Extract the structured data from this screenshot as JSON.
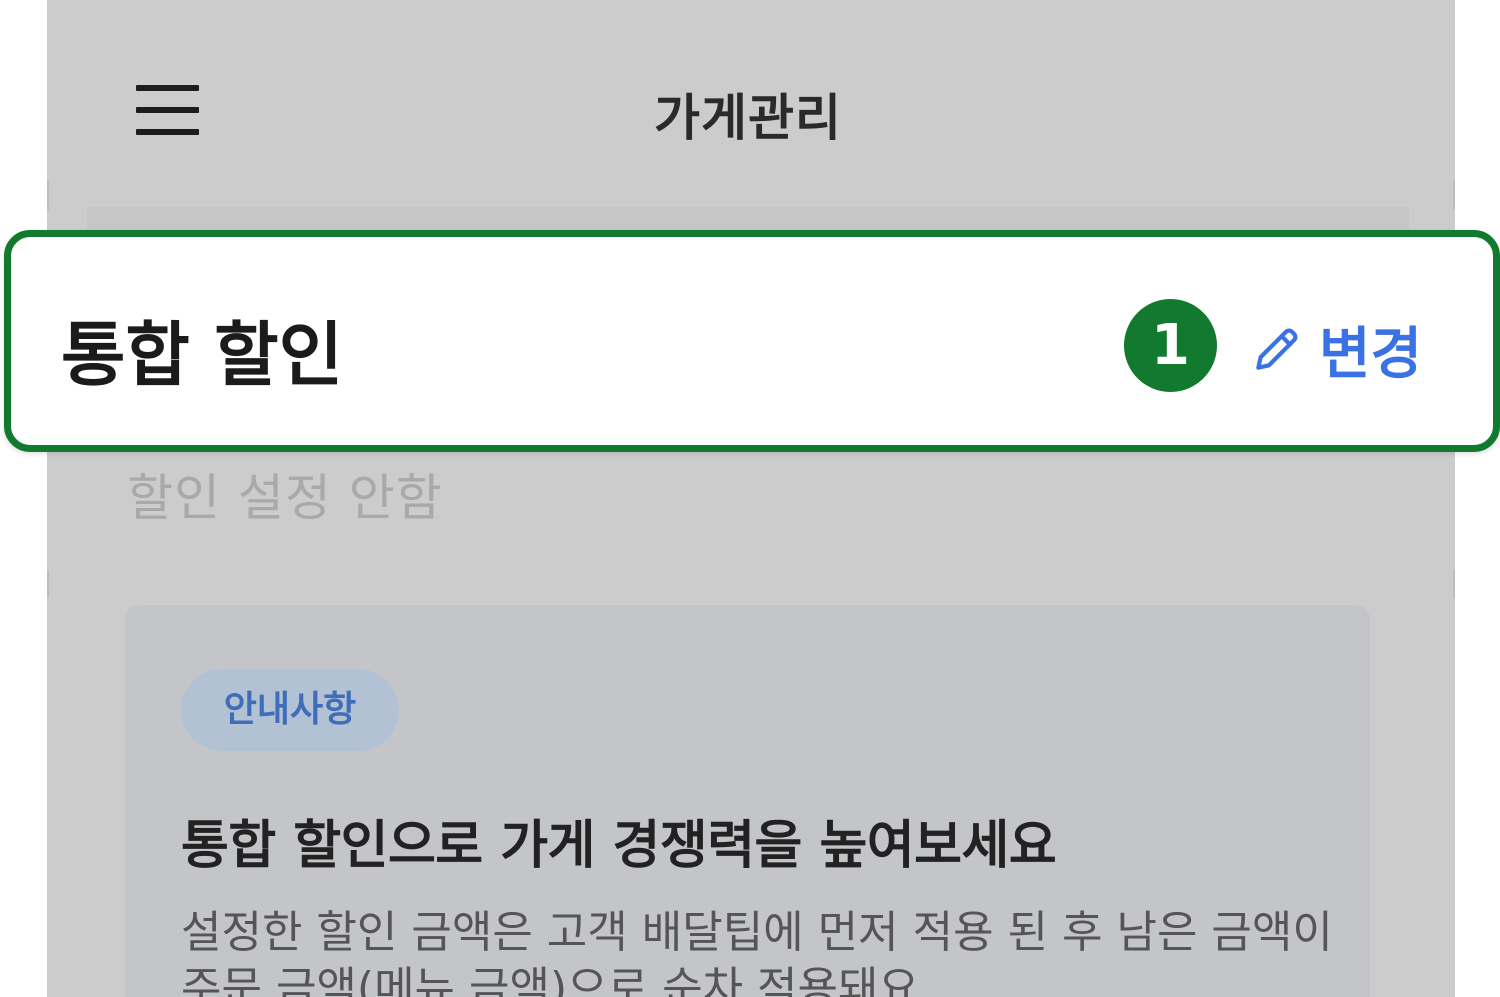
{
  "header": {
    "title": "가게관리",
    "menu_icon": "hamburger-menu-icon"
  },
  "discount_section": {
    "title": "통합 할인",
    "step_number": "1",
    "change_label": "변경",
    "change_icon": "pencil-icon",
    "status": "할인 설정 안함"
  },
  "notice": {
    "badge": "안내사항",
    "title": "통합 할인으로 가게 경쟁력을 높여보세요",
    "body": "설정한 할인 금액은 고객 배달팁에 먼저 적용 된 후 남은 금액이 주문 금액(메뉴 금액)으로 순차 적용돼요"
  },
  "colors": {
    "highlight_border": "#127a2e",
    "accent_blue": "#3a72e4",
    "overlay_gray": "#cccccc"
  }
}
